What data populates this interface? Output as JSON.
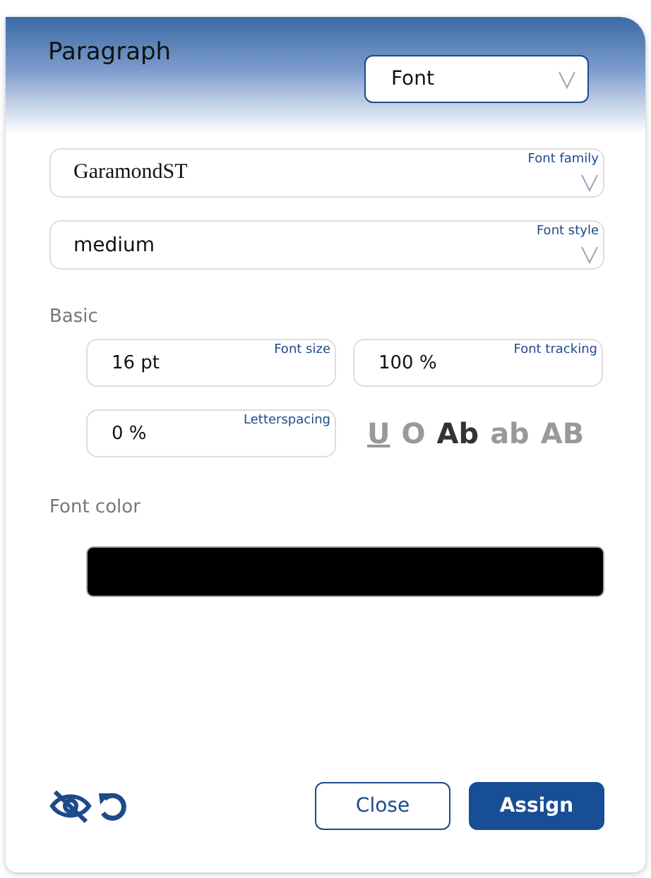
{
  "header": {
    "title": "Paragraph",
    "dropdown": {
      "value": "Font"
    }
  },
  "selects": [
    {
      "label": "Font family",
      "value": "GaramondST",
      "kind": "serif"
    },
    {
      "label": "Font style",
      "value": "medium",
      "kind": "sans"
    }
  ],
  "basic": {
    "title": "Basic",
    "fields": [
      {
        "label": "Font size",
        "value": "16 pt"
      },
      {
        "label": "Font tracking",
        "value": "100 %"
      },
      {
        "label": "Letterspacing",
        "value": "0 %"
      }
    ],
    "styles": [
      {
        "label": "U",
        "kind": "underline",
        "selected": false
      },
      {
        "label": "O",
        "kind": "outline",
        "selected": false
      },
      {
        "label": "Ab",
        "kind": "normal",
        "selected": true
      },
      {
        "label": "ab",
        "kind": "lower",
        "selected": false
      },
      {
        "label": "AB",
        "kind": "upper",
        "selected": false
      }
    ]
  },
  "font_color": {
    "title": "Font color",
    "color": "#000000"
  },
  "buttons": [
    {
      "label": "Close",
      "kind": "secondary"
    },
    {
      "label": "Assign",
      "kind": "primary"
    }
  ]
}
